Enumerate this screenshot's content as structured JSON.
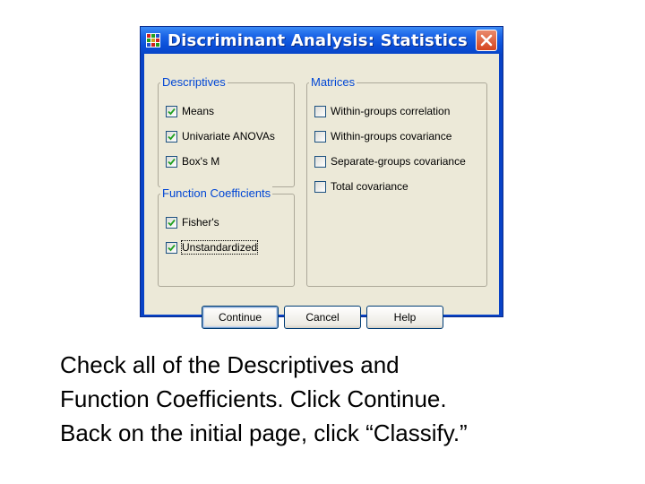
{
  "dialog": {
    "title": "Discriminant Analysis: Statistics",
    "icons": {
      "app": "spss-grid-icon",
      "close": "close-icon"
    },
    "colors": {
      "titlebar": "#0a4fd8",
      "close": "#d5441e",
      "legend_text": "#0046d5",
      "client": "#ece9d8"
    }
  },
  "descriptives": {
    "legend": "Descriptives",
    "items": [
      {
        "label": "Means",
        "checked": true
      },
      {
        "label": "Univariate ANOVAs",
        "checked": true
      },
      {
        "label": "Box's M",
        "checked": true
      }
    ]
  },
  "function_coefficients": {
    "legend": "Function Coefficients",
    "items": [
      {
        "label": "Fisher's",
        "checked": true
      },
      {
        "label": "Unstandardized",
        "checked": true,
        "focused": true
      }
    ]
  },
  "matrices": {
    "legend": "Matrices",
    "items": [
      {
        "label": "Within-groups correlation",
        "checked": false
      },
      {
        "label": "Within-groups covariance",
        "checked": false
      },
      {
        "label": "Separate-groups covariance",
        "checked": false
      },
      {
        "label": "Total covariance",
        "checked": false
      }
    ]
  },
  "buttons": {
    "continue": "Continue",
    "cancel": "Cancel",
    "help": "Help"
  },
  "caption": {
    "line1": "Check all of the Descriptives and",
    "line2": "Function Coefficients.  Click Continue.",
    "line3": "Back on the initial page, click “Classify.”"
  }
}
